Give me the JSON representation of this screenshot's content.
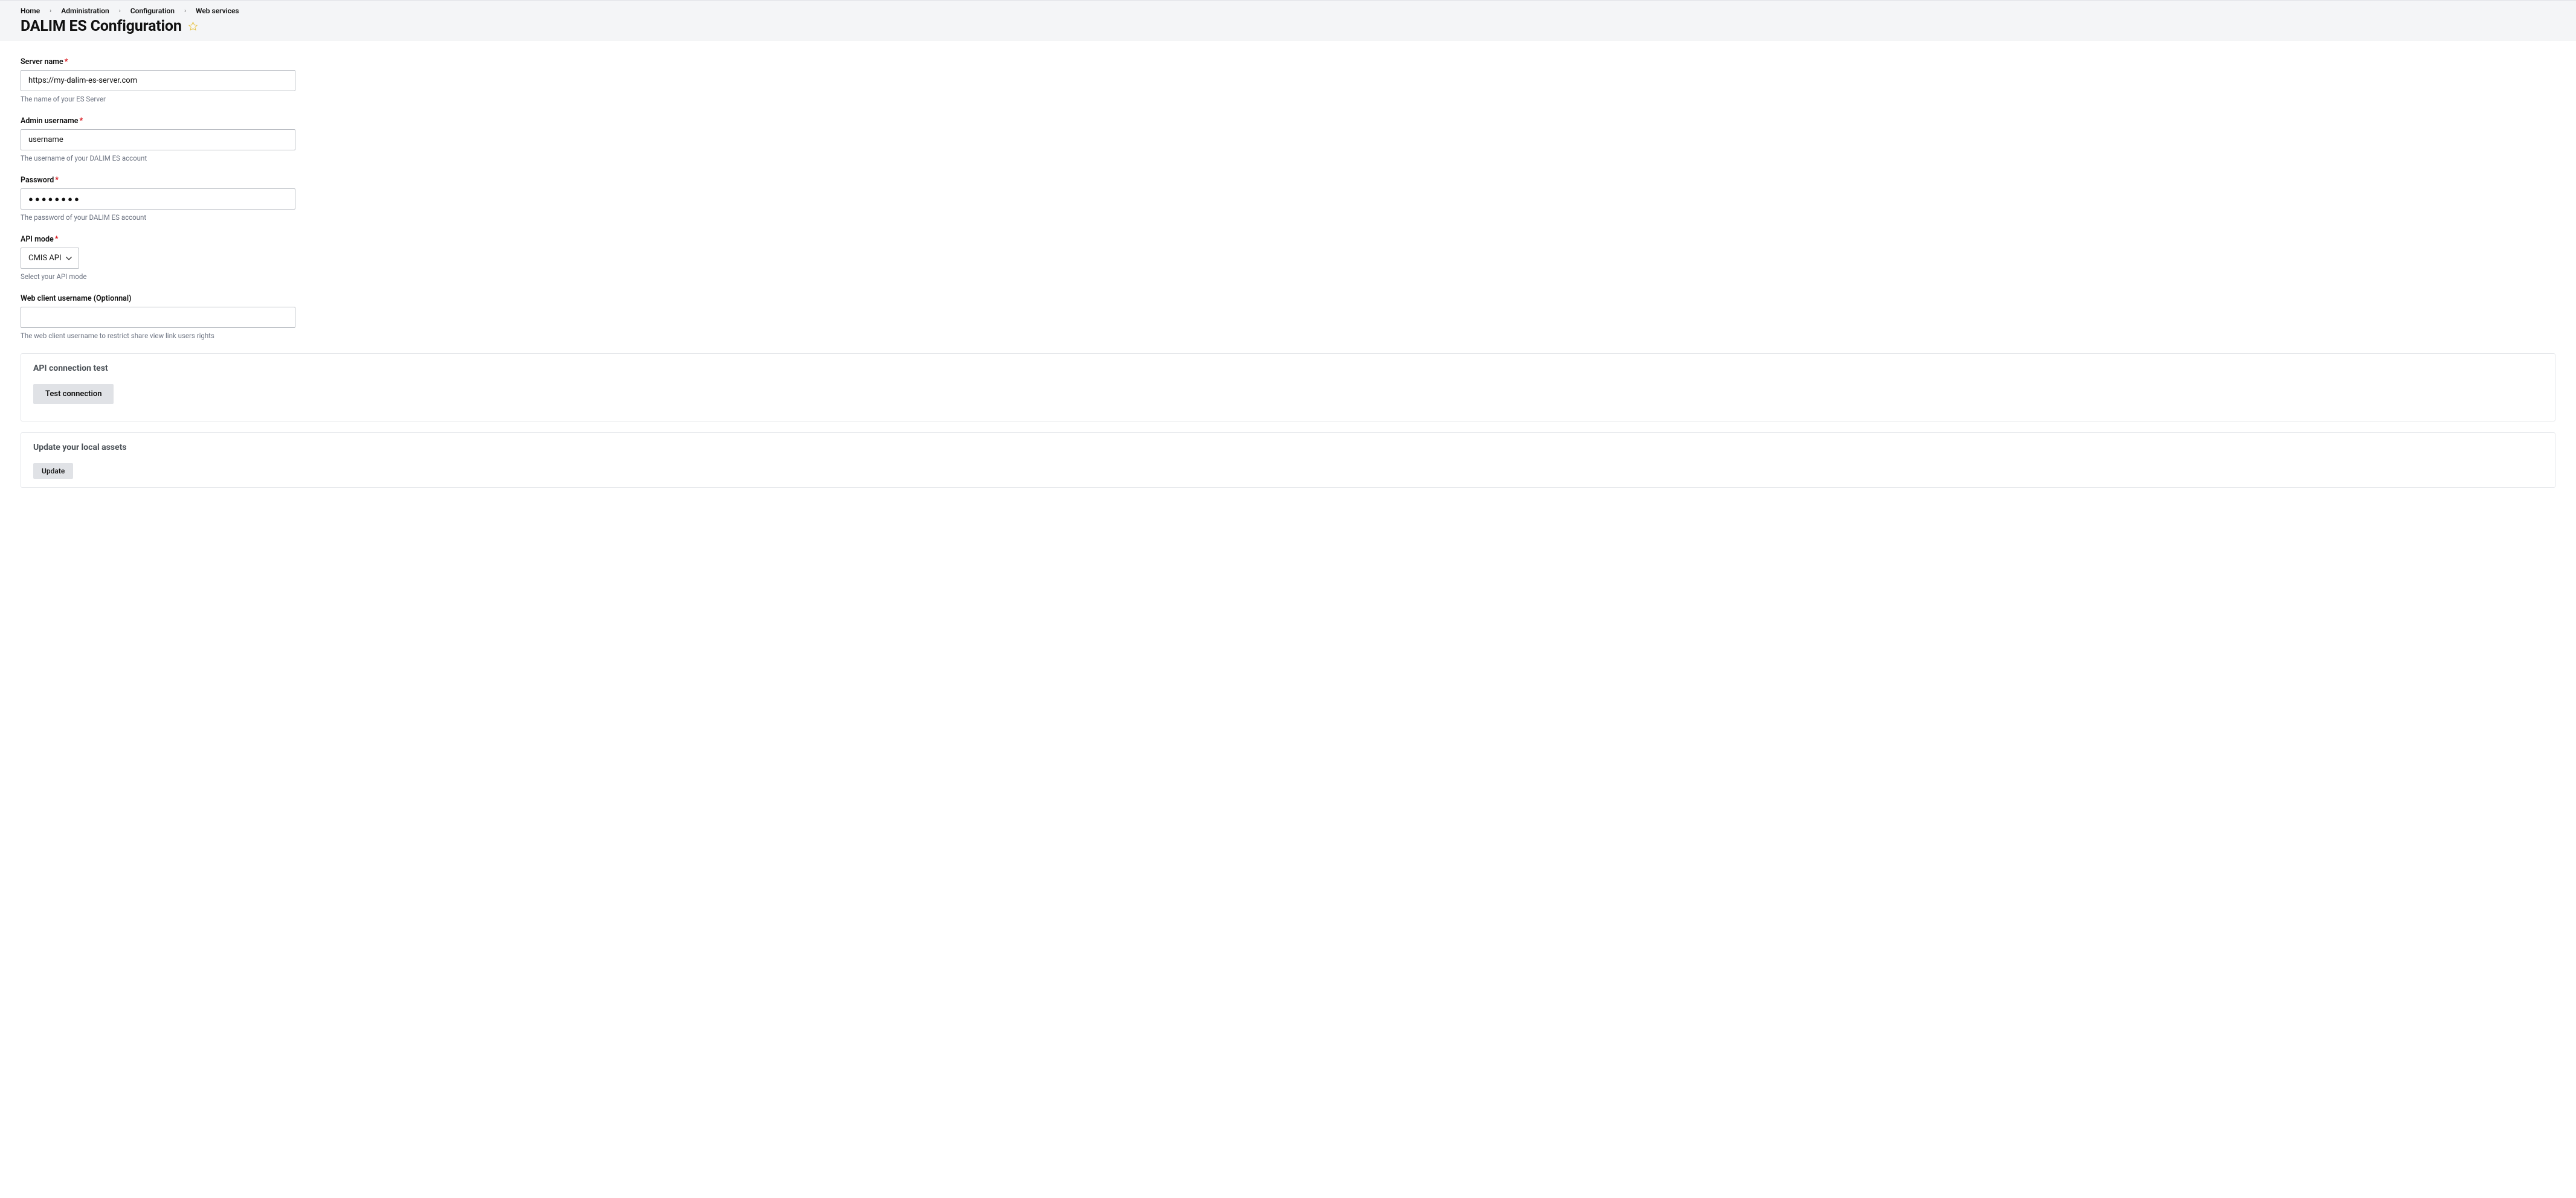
{
  "breadcrumb": {
    "items": [
      "Home",
      "Administration",
      "Configuration",
      "Web services"
    ]
  },
  "page": {
    "title": "DALIM ES Configuration"
  },
  "fields": {
    "server_name": {
      "label": "Server name",
      "required": "*",
      "value": "https://my-dalim-es-server.com",
      "help": "The name of your ES Server"
    },
    "admin_username": {
      "label": "Admin username",
      "required": "*",
      "value": "username",
      "help": "The username of your DALIM ES account"
    },
    "password": {
      "label": "Password",
      "required": "*",
      "value": "●●●●●●●●",
      "help": "The password of your DALIM ES account"
    },
    "api_mode": {
      "label": "API mode",
      "required": "*",
      "selected": "CMIS API",
      "help": "Select your API mode"
    },
    "web_client_username": {
      "label": "Web client username (Optionnal)",
      "value": "",
      "help": "The web client username to restrict share view link users rights"
    }
  },
  "panels": {
    "api_test": {
      "title": "API connection test",
      "button": "Test connection"
    },
    "update_assets": {
      "title": "Update your local assets",
      "button": "Update"
    }
  }
}
